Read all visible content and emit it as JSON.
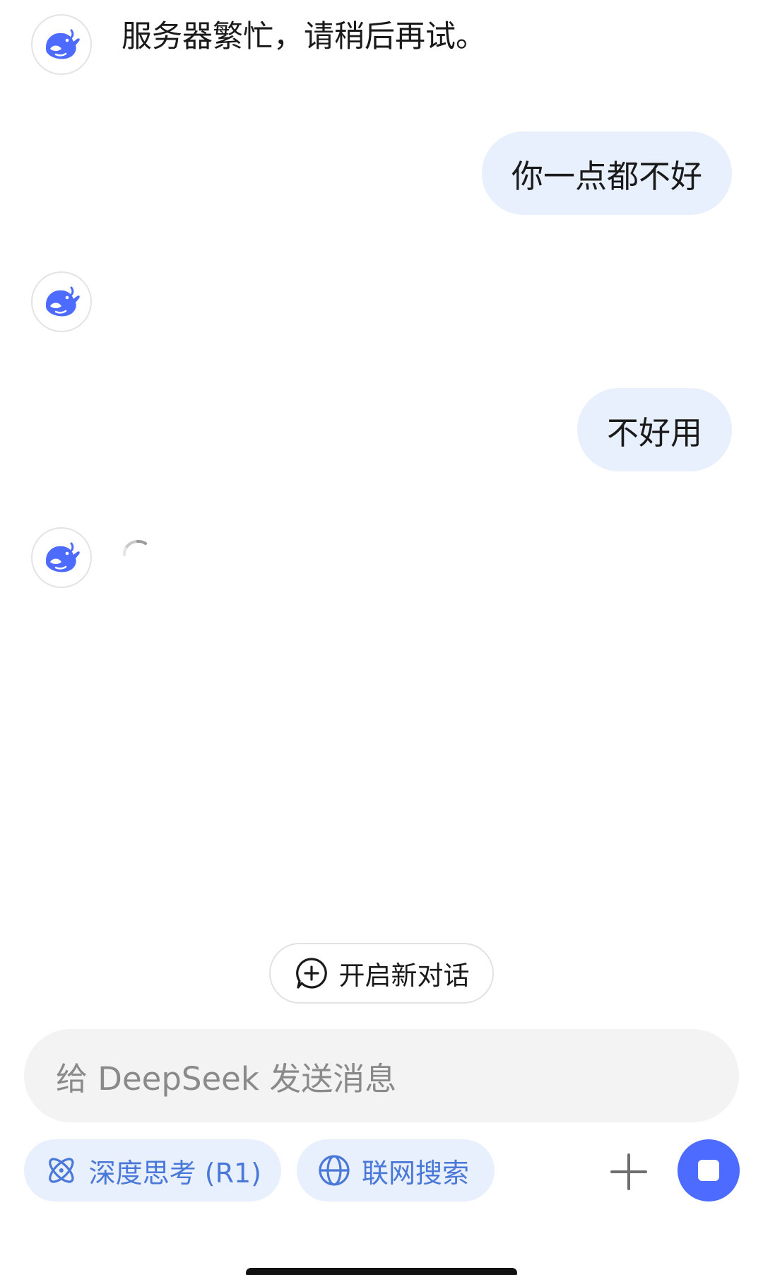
{
  "messages": [
    {
      "role": "assistant",
      "text": "服务器繁忙，请稍后再试。"
    },
    {
      "role": "user",
      "text": "你一点都不好"
    },
    {
      "role": "assistant",
      "text": ""
    },
    {
      "role": "user",
      "text": "不好用"
    },
    {
      "role": "assistant",
      "text": "",
      "loading": true
    }
  ],
  "new_chat_label": "开启新对话",
  "input": {
    "placeholder": "给 DeepSeek 发送消息",
    "value": ""
  },
  "toolbar": {
    "deep_think_label": "深度思考 (R1)",
    "web_search_label": "联网搜索"
  },
  "icons": {
    "assistant_avatar": "deepseek-whale-icon",
    "new_chat": "chat-plus-icon",
    "deep_think": "atom-icon",
    "web_search": "globe-icon",
    "attach": "plus-icon",
    "stop": "stop-icon"
  },
  "colors": {
    "accent": "#4d6bfe",
    "user_bubble": "#e8effd",
    "pill_text": "#4a78d9",
    "input_bg": "#f3f3f3"
  }
}
